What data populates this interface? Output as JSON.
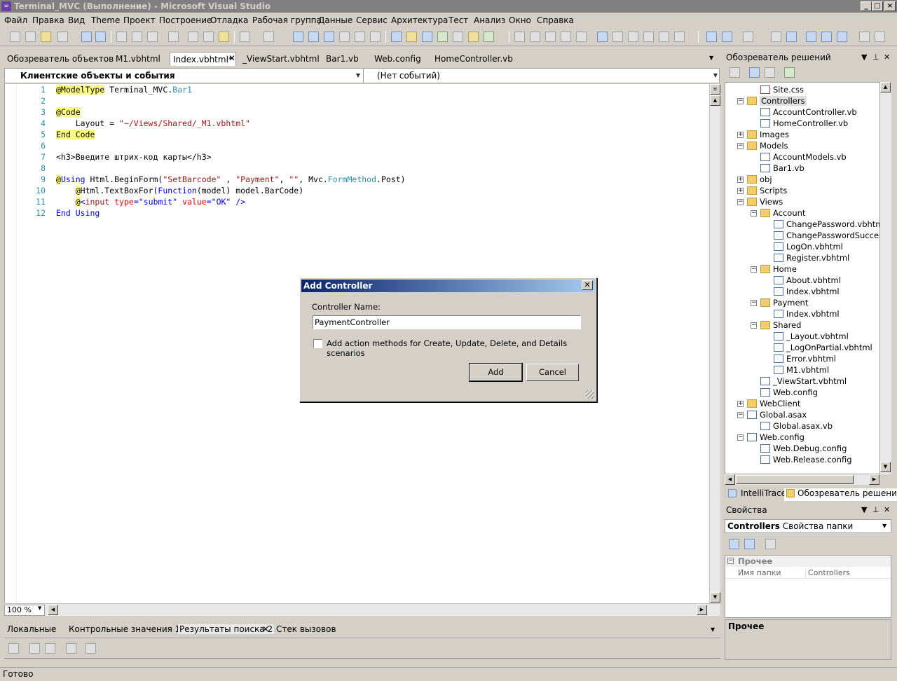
{
  "window": {
    "title": "Terminal_MVC (Выполнение) - Microsoft Visual Studio",
    "app_icon": "visual-studio-icon",
    "controls": [
      "_",
      "□",
      "×"
    ]
  },
  "menu": [
    "Файл",
    "Правка",
    "Вид",
    "Theme",
    "Проект",
    "Построение",
    "Отладка",
    "Рабочая группа",
    "Данные",
    "Сервис",
    "Архитектура",
    "Тест",
    "Анализ",
    "Окно",
    "Справка"
  ],
  "doc_tabs": [
    "Обозреватель объектов",
    "M1.vbhtml",
    "Index.vbhtml*",
    "_ViewStart.vbhtml",
    "Bar1.vb",
    "Web.config",
    "HomeController.vb"
  ],
  "nav": {
    "left_combo": "Клиентские объекты и события",
    "right_combo": "(Нет событий)"
  },
  "editor": {
    "line_numbers": [
      "1",
      "2",
      "3",
      "4",
      "5",
      "6",
      "7",
      "8",
      "9",
      "10",
      "11",
      "12"
    ],
    "lines": [
      [
        {
          "t": "@ModelType",
          "c": "hl"
        },
        {
          "t": " Terminal_MVC.",
          "c": ""
        },
        {
          "t": "Bar1",
          "c": "tp"
        }
      ],
      [],
      [
        {
          "t": "@Code",
          "c": "hl"
        }
      ],
      [
        {
          "t": "    Layout = ",
          "c": ""
        },
        {
          "t": "\"~/Views/Shared/_M1.vbhtml\"",
          "c": "st"
        }
      ],
      [
        {
          "t": "End Code",
          "c": "hl"
        }
      ],
      [],
      [
        {
          "t": "<h3>Введите штрих-код карты</h3>",
          "c": ""
        }
      ],
      [],
      [
        {
          "t": "@",
          "c": "hl"
        },
        {
          "t": "Using",
          "c": "kw"
        },
        {
          "t": " Html.BeginForm(",
          "c": ""
        },
        {
          "t": "\"SetBarcode\"",
          "c": "st"
        },
        {
          "t": " , ",
          "c": ""
        },
        {
          "t": "\"Payment\"",
          "c": "st"
        },
        {
          "t": ", ",
          "c": ""
        },
        {
          "t": "\"\"",
          "c": "st"
        },
        {
          "t": ", Mvc.",
          "c": ""
        },
        {
          "t": "FormMethod",
          "c": "tp"
        },
        {
          "t": ".Post)",
          "c": ""
        }
      ],
      [
        {
          "t": "    ",
          "c": ""
        },
        {
          "t": "@",
          "c": "hl"
        },
        {
          "t": "Html.TextBoxFor(",
          "c": ""
        },
        {
          "t": "Function",
          "c": "kw"
        },
        {
          "t": "(model) model.BarCode)",
          "c": ""
        }
      ],
      [
        {
          "t": "    ",
          "c": ""
        },
        {
          "t": "@",
          "c": "hl"
        },
        {
          "t": "<",
          "c": "kw"
        },
        {
          "t": "input",
          "c": "tg"
        },
        {
          "t": " type",
          "c": "at"
        },
        {
          "t": "=",
          "c": "kw"
        },
        {
          "t": "\"submit\"",
          "c": "kw"
        },
        {
          "t": " value",
          "c": "at"
        },
        {
          "t": "=",
          "c": "kw"
        },
        {
          "t": "\"OK\"",
          "c": "kw"
        },
        {
          "t": " />",
          "c": "kw"
        }
      ],
      [
        {
          "t": "End ",
          "c": "kw"
        },
        {
          "t": "Using",
          "c": "kw"
        }
      ]
    ],
    "zoom": "100 %"
  },
  "bottom_tabs": [
    "Локальные",
    "Контрольные значения 1",
    "Результаты поиска 2",
    "Стек вызовов"
  ],
  "status": "Готово",
  "solution_explorer": {
    "title": "Обозреватель решений",
    "items": [
      {
        "label": "Site.css",
        "kind": "css",
        "depth": 2
      },
      {
        "label": "Controllers",
        "kind": "folder",
        "depth": 1,
        "exp": "−",
        "selected": true
      },
      {
        "label": "AccountController.vb",
        "kind": "file",
        "depth": 2
      },
      {
        "label": "HomeController.vb",
        "kind": "file",
        "depth": 2
      },
      {
        "label": "Images",
        "kind": "folder",
        "depth": 1,
        "exp": "+"
      },
      {
        "label": "Models",
        "kind": "folder",
        "depth": 1,
        "exp": "−"
      },
      {
        "label": "AccountModels.vb",
        "kind": "file",
        "depth": 2
      },
      {
        "label": "Bar1.vb",
        "kind": "file",
        "depth": 2
      },
      {
        "label": "obj",
        "kind": "folder",
        "depth": 1,
        "exp": "+"
      },
      {
        "label": "Scripts",
        "kind": "folder",
        "depth": 1,
        "exp": "+"
      },
      {
        "label": "Views",
        "kind": "folder",
        "depth": 1,
        "exp": "−"
      },
      {
        "label": "Account",
        "kind": "folder",
        "depth": 2,
        "exp": "−"
      },
      {
        "label": "ChangePassword.vbhtml",
        "kind": "file",
        "depth": 3
      },
      {
        "label": "ChangePasswordSuccess.vb",
        "kind": "file",
        "depth": 3
      },
      {
        "label": "LogOn.vbhtml",
        "kind": "file",
        "depth": 3
      },
      {
        "label": "Register.vbhtml",
        "kind": "file",
        "depth": 3
      },
      {
        "label": "Home",
        "kind": "folder",
        "depth": 2,
        "exp": "−"
      },
      {
        "label": "About.vbhtml",
        "kind": "file",
        "depth": 3
      },
      {
        "label": "Index.vbhtml",
        "kind": "file",
        "depth": 3
      },
      {
        "label": "Payment",
        "kind": "folder",
        "depth": 2,
        "exp": "−"
      },
      {
        "label": "Index.vbhtml",
        "kind": "file",
        "depth": 3
      },
      {
        "label": "Shared",
        "kind": "folder",
        "depth": 2,
        "exp": "−"
      },
      {
        "label": "_Layout.vbhtml",
        "kind": "file",
        "depth": 3
      },
      {
        "label": "_LogOnPartial.vbhtml",
        "kind": "file",
        "depth": 3
      },
      {
        "label": "Error.vbhtml",
        "kind": "file",
        "depth": 3
      },
      {
        "label": "M1.vbhtml",
        "kind": "file",
        "depth": 3
      },
      {
        "label": "_ViewStart.vbhtml",
        "kind": "file",
        "depth": 2
      },
      {
        "label": "Web.config",
        "kind": "file",
        "depth": 2
      },
      {
        "label": "WebClient",
        "kind": "folder",
        "depth": 1,
        "exp": "+"
      },
      {
        "label": "Global.asax",
        "kind": "file",
        "depth": 1,
        "exp": "−"
      },
      {
        "label": "Global.asax.vb",
        "kind": "file",
        "depth": 2
      },
      {
        "label": "Web.config",
        "kind": "file",
        "depth": 1,
        "exp": "−"
      },
      {
        "label": "Web.Debug.config",
        "kind": "file",
        "depth": 2
      },
      {
        "label": "Web.Release.config",
        "kind": "file",
        "depth": 2
      }
    ],
    "tabs": [
      "IntelliTrace",
      "Обозреватель решений"
    ]
  },
  "properties": {
    "title": "Свойства",
    "object_bold": "Controllers",
    "object_type": "Свойства папки",
    "category": "Прочее",
    "row_name": "Имя папки",
    "row_value": "Controllers",
    "desc_title": "Прочее"
  },
  "dialog": {
    "title": "Add Controller",
    "name_label": "Controller Name:",
    "name_value": "PaymentController",
    "checkbox_label": "Add action methods for Create, Update, Delete, and Details scenarios",
    "add_button": "Add",
    "cancel_button": "Cancel"
  },
  "colors": {
    "title_bar": "#808080",
    "dialog_title_start": "#0a246a",
    "dialog_title_end": "#a6caf0",
    "line_number": "#2b91af",
    "razor_highlight": "#ffff80"
  }
}
